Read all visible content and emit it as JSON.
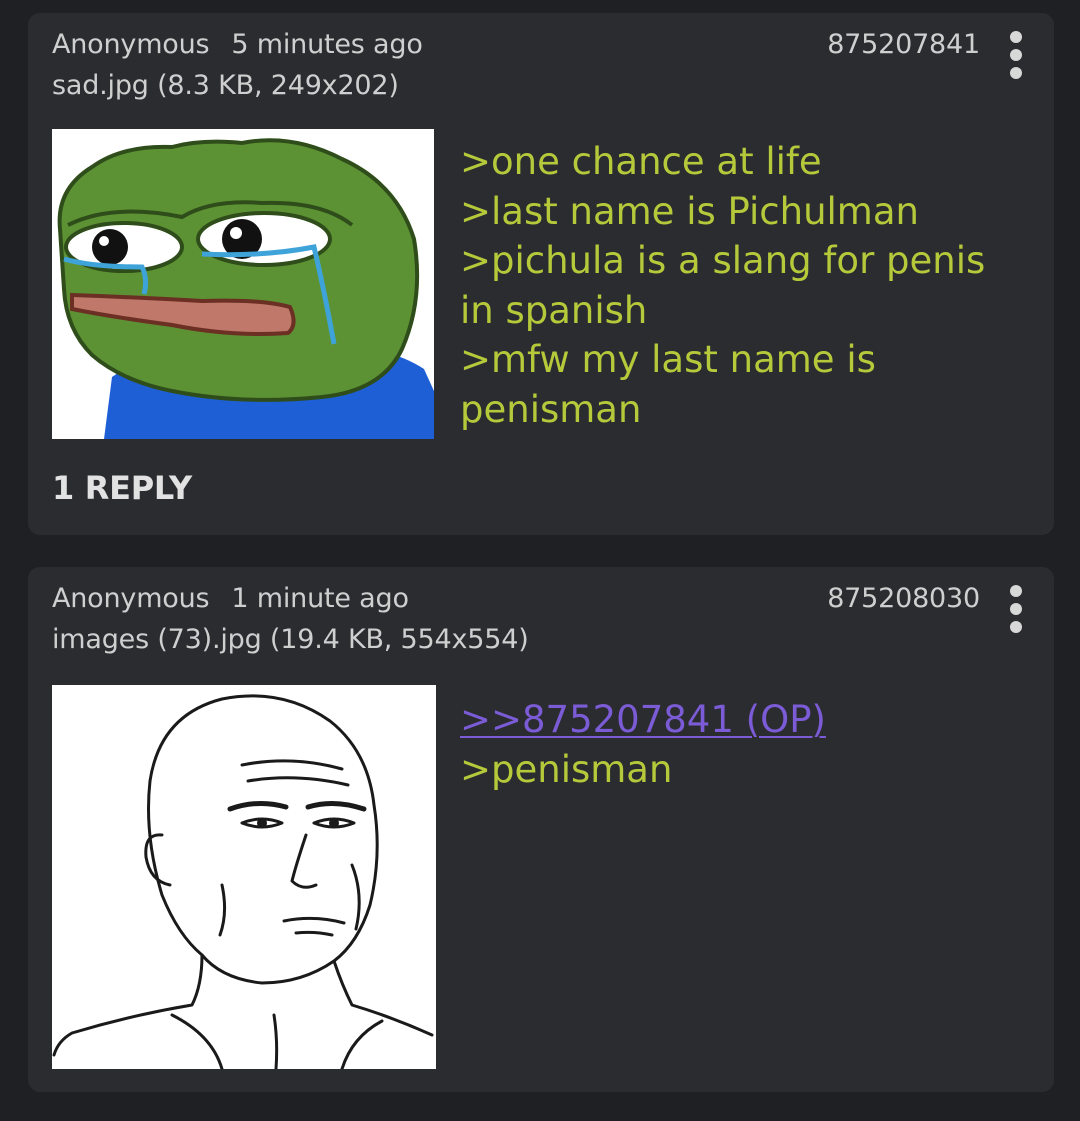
{
  "posts": [
    {
      "name": "Anonymous",
      "time": "5 minutes ago",
      "file": "sad.jpg (8.3 KB, 249x202)",
      "number": "875207841",
      "image_name": "crying-frog-image",
      "lines": [
        ">one chance at life",
        ">last name is Pichulman",
        ">pichula is a slang for penis in spanish",
        ">mfw my last name is penisman"
      ],
      "replies": "1 REPLY"
    },
    {
      "name": "Anonymous",
      "time": "1 minute ago",
      "file": "images (73).jpg (19.4 KB, 554x554)",
      "number": "875208030",
      "image_name": "wojak-face-image",
      "backlink": ">>875207841 (OP)",
      "lines": [
        ">penisman"
      ]
    }
  ],
  "colors": {
    "background": "#1f2023",
    "card": "#2b2c30",
    "greentext": "#b5c93a",
    "backlink": "#7b5bd6"
  }
}
